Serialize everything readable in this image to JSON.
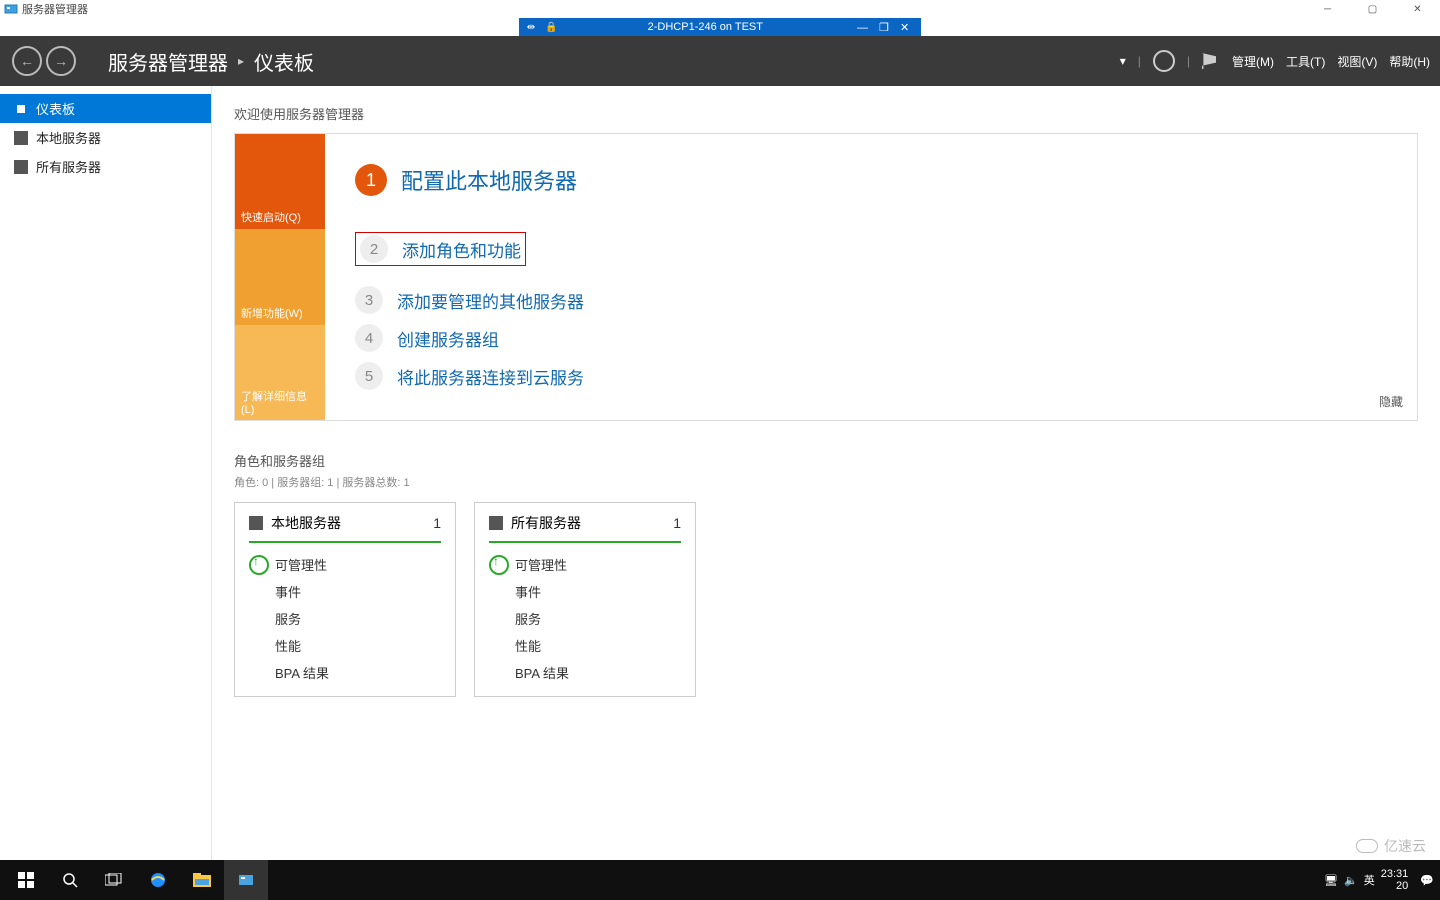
{
  "outer_window": {
    "title": "服务器管理器"
  },
  "vm_bar": {
    "title": "2-DHCP1-246 on TEST"
  },
  "ribbon": {
    "crumb_root": "服务器管理器",
    "crumb_page": "仪表板",
    "menu": {
      "manage": "管理(M)",
      "tools": "工具(T)",
      "view": "视图(V)",
      "help": "帮助(H)"
    }
  },
  "sidebar": {
    "items": [
      {
        "label": "仪表板"
      },
      {
        "label": "本地服务器"
      },
      {
        "label": "所有服务器"
      }
    ]
  },
  "welcome": {
    "heading": "欢迎使用服务器管理器",
    "tiles": {
      "quick": "快速启动(Q)",
      "new": "新增功能(W)",
      "learn": "了解详细信息(L)"
    },
    "steps": [
      {
        "num": "1",
        "label": "配置此本地服务器"
      },
      {
        "num": "2",
        "label": "添加角色和功能"
      },
      {
        "num": "3",
        "label": "添加要管理的其他服务器"
      },
      {
        "num": "4",
        "label": "创建服务器组"
      },
      {
        "num": "5",
        "label": "将此服务器连接到云服务"
      }
    ],
    "hide": "隐藏"
  },
  "roles": {
    "title": "角色和服务器组",
    "subtitle": "角色: 0 | 服务器组: 1 | 服务器总数: 1",
    "cards": [
      {
        "title": "本地服务器",
        "count": "1",
        "rows": [
          "可管理性",
          "事件",
          "服务",
          "性能",
          "BPA 结果"
        ]
      },
      {
        "title": "所有服务器",
        "count": "1",
        "rows": [
          "可管理性",
          "事件",
          "服务",
          "性能",
          "BPA 结果"
        ]
      }
    ]
  },
  "taskbar": {
    "ime": "英",
    "time": "23:31",
    "date_short": "20"
  },
  "watermark": "亿速云"
}
